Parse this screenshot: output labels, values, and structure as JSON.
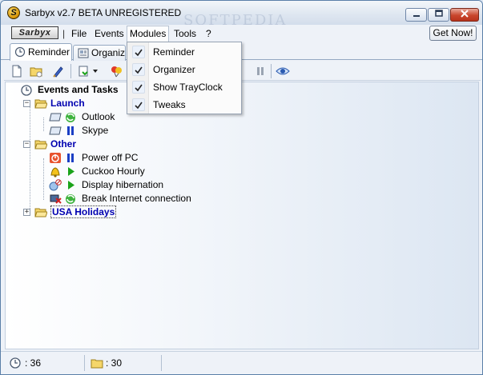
{
  "window": {
    "title": "Sarbyx v2.7 BETA UNREGISTERED",
    "watermark": "SOFTPEDIA"
  },
  "menubar": {
    "brand": "Sarbyx",
    "separator": "|",
    "items": [
      "File",
      "Events",
      "Modules",
      "Tools",
      "?"
    ],
    "get_now": "Get Now!"
  },
  "modules_menu": {
    "items": [
      {
        "label": "Reminder",
        "checked": true
      },
      {
        "label": "Organizer",
        "checked": true
      },
      {
        "label": "Show TrayClock",
        "checked": true
      },
      {
        "label": "Tweaks",
        "checked": true
      }
    ]
  },
  "tabs": [
    {
      "label": "Reminder",
      "selected": true
    },
    {
      "label": "Organizer",
      "selected": false
    }
  ],
  "tree": {
    "root": "Events and Tasks",
    "groups": [
      {
        "label": "Launch",
        "items": [
          "Outlook",
          "Skype"
        ]
      },
      {
        "label": "Other",
        "items": [
          "Power off PC",
          "Cuckoo Hourly",
          "Display hibernation",
          "Break Internet connection"
        ]
      },
      {
        "label": "USA Holidays",
        "items": []
      }
    ]
  },
  "statusbar": {
    "reminder_count": ": 36",
    "folder_count": ": 30"
  },
  "colors": {
    "group_label": "#0000b0",
    "play_green": "#1aa31a",
    "pause_blue": "#1a3fc4",
    "close_red": "#c9462c"
  }
}
